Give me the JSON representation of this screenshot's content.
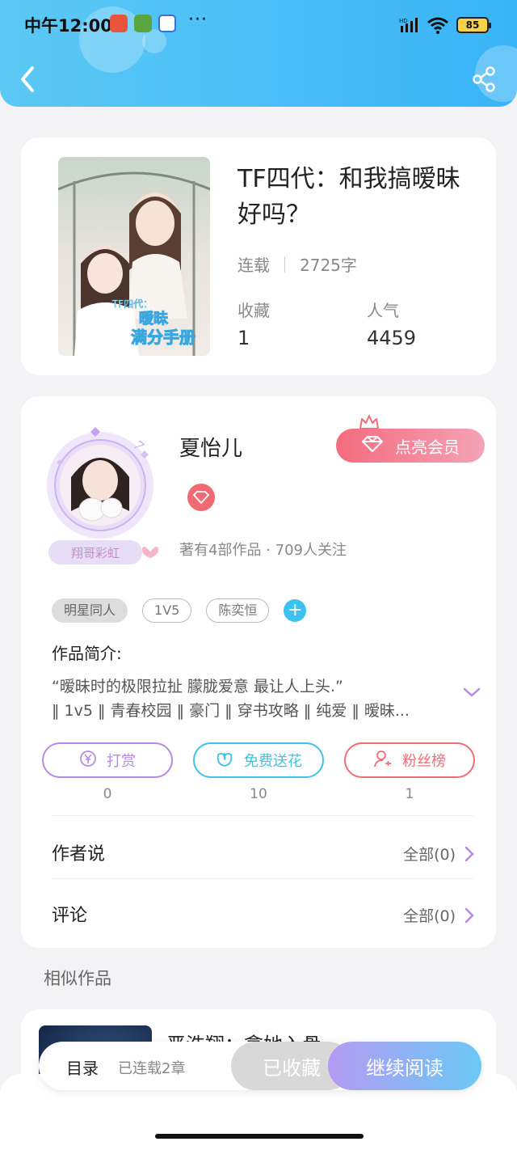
{
  "status_bar": {
    "time": "中午12:00",
    "dots": "···",
    "signal_label": "HD",
    "battery": "85"
  },
  "book": {
    "title": "TF四代：和我搞暧昧好吗？",
    "status": "连载",
    "word_count": "2725字",
    "favorites_label": "收藏",
    "favorites_value": "1",
    "popularity_label": "人气",
    "popularity_value": "4459",
    "cover_text_top": "TF四代：",
    "cover_text_main": "暧昧",
    "cover_text_sub": "满分手册"
  },
  "author": {
    "name": "夏怡儿",
    "vip_button": "点亮会员",
    "avatar_badge": "翔哥彩虹",
    "stats": "著有4部作品 · 709人关注"
  },
  "tags": [
    "明星同人",
    "1V5",
    "陈奕恒"
  ],
  "intro": {
    "label": "作品简介:",
    "line1": "“暧昧时的极限拉扯 朦胧爱意 最让人上头.”",
    "line2": "‖ 1v5 ‖ 青春校园 ‖ 豪门 ‖ 穿书攻略 ‖ 纯爱 ‖ 暧昧..."
  },
  "actions": [
    {
      "label": "打赏",
      "count": "0",
      "color": "#b58ae6"
    },
    {
      "label": "免费送花",
      "count": "10",
      "color": "#3cc4e6"
    },
    {
      "label": "粉丝榜",
      "count": "1",
      "color": "#f06d76"
    }
  ],
  "rows": [
    {
      "label": "作者说",
      "right": "全部(0)"
    },
    {
      "label": "评论",
      "right": "全部(0)"
    }
  ],
  "similar": {
    "label": "相似作品",
    "first_title": "严浩翔：拿她入骨"
  },
  "bottom": {
    "toc": "目录",
    "chapters": "已连载2章",
    "collected": "已收藏",
    "continue": "继续阅读"
  }
}
